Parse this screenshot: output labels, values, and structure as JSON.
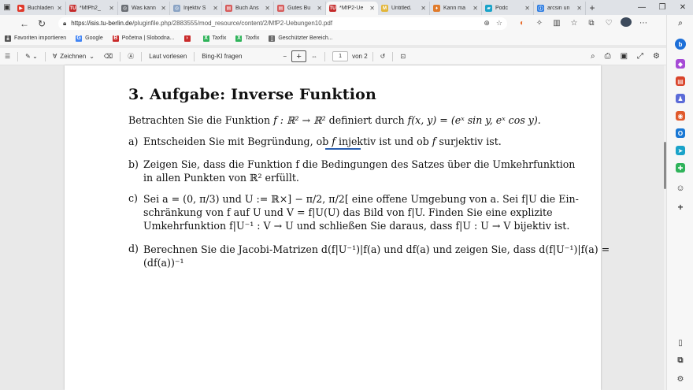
{
  "tabs": [
    {
      "title": "Buchladen",
      "fav_color": "#e0392b",
      "fav_glyph": "▶"
    },
    {
      "title": "*MfPh2_",
      "fav_color": "#c42a2a",
      "fav_glyph": "TU"
    },
    {
      "title": "Was kann",
      "fav_color": "#6b6f75",
      "fav_glyph": "◎"
    },
    {
      "title": "Injektiv S",
      "fav_color": "#8aa3c4",
      "fav_glyph": "◎"
    },
    {
      "title": "Buch Ans",
      "fav_color": "#d65c5c",
      "fav_glyph": "▤"
    },
    {
      "title": "Gutes Bu",
      "fav_color": "#d65c5c",
      "fav_glyph": "▤"
    },
    {
      "title": "*MfP2-Ue",
      "fav_color": "#c42a2a",
      "fav_glyph": "TU",
      "active": true
    },
    {
      "title": "Untitled.",
      "fav_color": "#e2b63a",
      "fav_glyph": "M"
    },
    {
      "title": "Kann ma",
      "fav_color": "#e07b2b",
      "fav_glyph": "♦"
    },
    {
      "title": "Podc",
      "fav_color": "#1aa3c9",
      "fav_glyph": "▰"
    },
    {
      "title": "arcsin un",
      "fav_color": "#2f7de1",
      "fav_glyph": "ⓘ"
    }
  ],
  "address": {
    "host": "https://isis.tu-berlin.de",
    "path": "/pluginfile.php/2883555/mod_resource/content/2/MfP2-Uebungen10.pdf"
  },
  "bookmarks": [
    {
      "label": "Favoriten importieren",
      "color": "#555555",
      "glyph": "⤓"
    },
    {
      "label": "Google",
      "color": "#4285f4",
      "glyph": "G"
    },
    {
      "label": "Početna | Slobodna...",
      "color": "#c92a2a",
      "glyph": "B"
    },
    {
      "label": "",
      "color": "#c92a2a",
      "glyph": "›"
    },
    {
      "label": "Taxfix",
      "color": "#2fb35a",
      "glyph": "X"
    },
    {
      "label": "Taxfix",
      "color": "#2fb35a",
      "glyph": "X"
    },
    {
      "label": "Geschützter Bereich...",
      "color": "#666666",
      "glyph": "▯"
    }
  ],
  "pdf_toolbar": {
    "draw": "Zeichnen",
    "read_aloud": "Laut vorlesen",
    "ask_bing": "Bing-KI fragen",
    "page": "1",
    "of_pages": "von 2"
  },
  "doc": {
    "heading": "3. Aufgabe: Inverse Funktion",
    "intro_a": "Betrachten Sie die Funktion ",
    "intro_math": "f : ℝ² → ℝ²",
    "intro_b": " definiert durch ",
    "intro_math2": "f(x, y) = (eˣ sin y, eˣ cos y).",
    "a_label": "a)",
    "a_text1": "Entscheiden Sie mit Begründung, ob ",
    "a_f1": "f",
    "a_inj": " injektiv",
    "a_text2": " ist und ob ",
    "a_f2": "f",
    "a_text3": " surjektiv ist.",
    "b_label": "b)",
    "b_line1": "Zeigen Sie, dass die Funktion f die Bedingungen des Satzes über die Umkehrfunktion",
    "b_line2": "in allen Punkten von ℝ² erfüllt.",
    "c_label": "c)",
    "c_line1": "Sei a = (0, π/3) und U := ℝ×] − π/2, π/2[ eine offene Umgebung von a. Sei f|U die Ein-",
    "c_line2": "schränkung von f auf U und V = f|U(U) das Bild von f|U. Finden Sie eine explizite",
    "c_line3": "Umkehrfunktion f|U⁻¹ : V → U und schließen Sie daraus, dass f|U : U → V bijektiv ist.",
    "d_label": "d)",
    "d_line1": "Berechnen Sie die Jacobi-Matrizen d(f|U⁻¹)|f(a) und df(a) und zeigen Sie, dass d(f|U⁻¹)|f(a) =",
    "d_line2": "(df(a))⁻¹"
  }
}
